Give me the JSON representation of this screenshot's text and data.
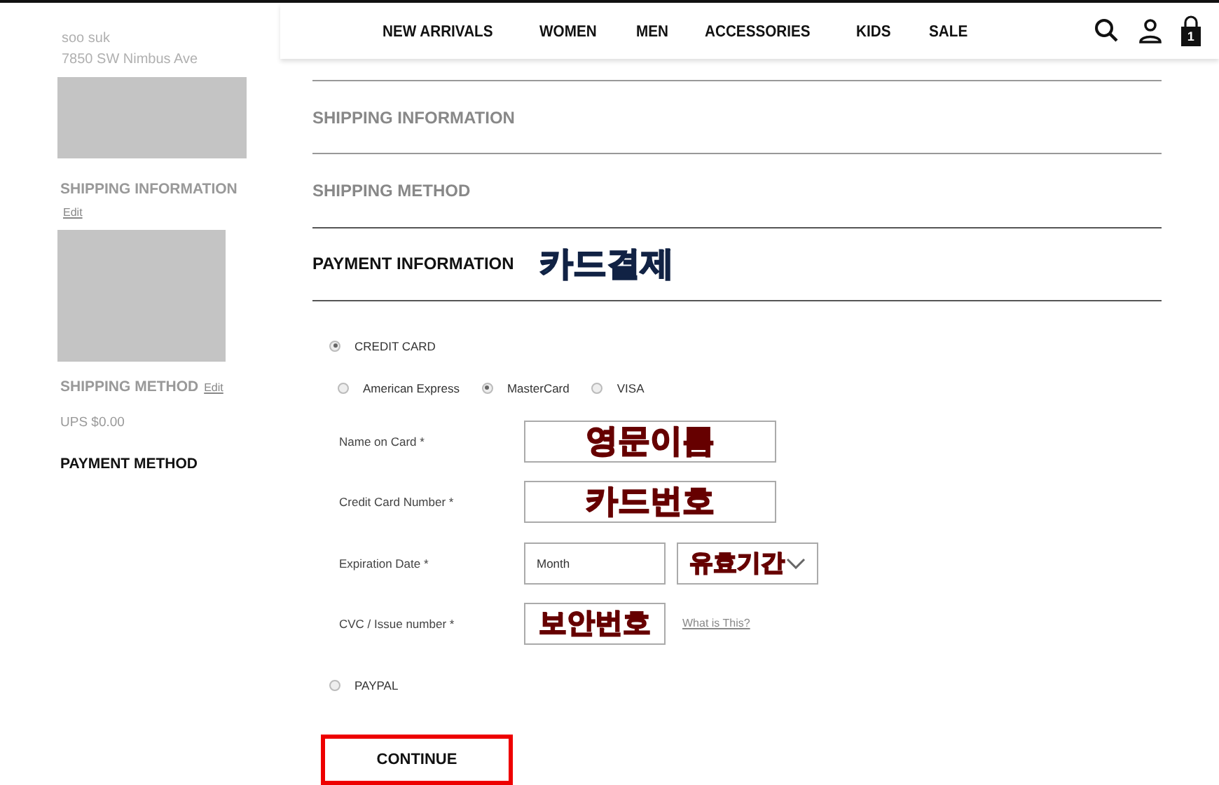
{
  "header": {
    "nav": [
      "NEW ARRIVALS",
      "WOMEN",
      "MEN",
      "ACCESSORIES",
      "KIDS",
      "SALE"
    ],
    "cart_count": "1"
  },
  "sidebar": {
    "address": [
      "soo suk",
      "7850 SW Nimbus Ave"
    ],
    "shipping_information": {
      "title": "SHIPPING INFORMATION",
      "edit": "Edit"
    },
    "shipping_method": {
      "title": "SHIPPING METHOD",
      "edit": "Edit",
      "value": "UPS $0.00"
    },
    "payment_method": {
      "title": "PAYMENT METHOD"
    }
  },
  "sections": [
    {
      "title": "SHIPPING INFORMATION",
      "active": false
    },
    {
      "title": "SHIPPING METHOD",
      "active": false
    },
    {
      "title": "PAYMENT INFORMATION",
      "active": true,
      "annotation": "카드결제"
    }
  ],
  "payment_options": [
    {
      "label": "CREDIT CARD",
      "selected": true
    },
    {
      "label": "PAYPAL",
      "selected": false
    }
  ],
  "card_types": [
    {
      "label": "American Express",
      "selected": false
    },
    {
      "label": "MasterCard",
      "selected": true
    },
    {
      "label": "VISA",
      "selected": false
    }
  ],
  "fields": [
    {
      "kind": "text",
      "label": "Name on Card *",
      "annotation": "영문이름"
    },
    {
      "kind": "text",
      "label": "Credit Card Number *",
      "annotation": "카드번호"
    },
    {
      "kind": "date",
      "label": "Expiration Date *",
      "month": "Month",
      "annotation": "유효기간"
    },
    {
      "kind": "cvc",
      "label": "CVC / Issue number *",
      "link": "What is This?",
      "annotation": "보안번호"
    }
  ],
  "continue_button": "CONTINUE"
}
